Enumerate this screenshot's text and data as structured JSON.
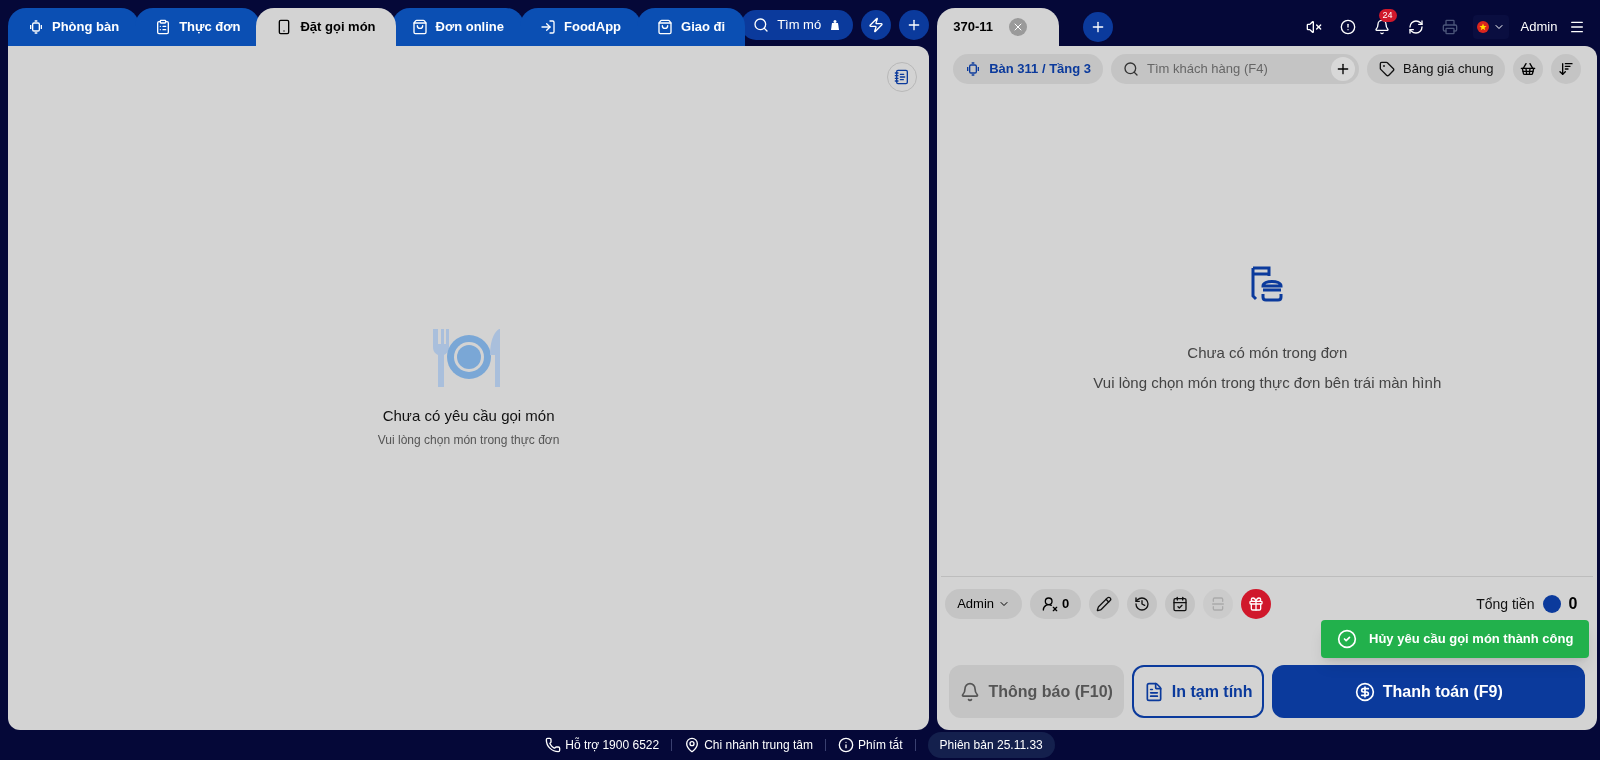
{
  "left_tabs": [
    {
      "kind": "table",
      "label": "Phòng bàn",
      "selected": false
    },
    {
      "kind": "menu",
      "label": "Thực đơn",
      "selected": false
    },
    {
      "kind": "phone",
      "label": "Đặt gọi món",
      "selected": true
    },
    {
      "kind": "bag",
      "label": "Đơn online",
      "selected": false
    },
    {
      "kind": "login",
      "label": "FoodApp",
      "selected": false
    },
    {
      "kind": "bag",
      "label": "Giao đi",
      "selected": false
    }
  ],
  "search_button": {
    "label": "Tìm mó"
  },
  "order_requests": {
    "empty_title": "Chưa có yêu cầu gọi món",
    "empty_hint": "Vui lòng chọn món trong thực đơn"
  },
  "order_tab": {
    "label": "370-11"
  },
  "header_icons": [
    {
      "kind": "mute",
      "disabled": false
    },
    {
      "kind": "alert",
      "disabled": false
    },
    {
      "kind": "bell",
      "disabled": false,
      "badge": "24"
    },
    {
      "kind": "refresh",
      "disabled": false
    },
    {
      "kind": "print",
      "disabled": true
    }
  ],
  "user": "Admin",
  "table_chip": "Bàn 311 / Tầng 3",
  "customer_search": {
    "placeholder": "Tìm khách hàng (F4)"
  },
  "price_list": "Bảng giá chung",
  "cart": {
    "empty_title": "Chưa có món trong đơn",
    "empty_hint": "Vui lòng chọn món trong thực đơn bên trái màn hình"
  },
  "staff_select": "Admin",
  "guest_count": "0",
  "tools": [
    {
      "kind": "edit",
      "disabled": false
    },
    {
      "kind": "history",
      "disabled": false
    },
    {
      "kind": "calendar",
      "disabled": false
    },
    {
      "kind": "split",
      "disabled": true
    },
    {
      "kind": "gift",
      "disabled": false
    }
  ],
  "total": {
    "label": "Tổng tiền",
    "value": "0"
  },
  "actions": [
    {
      "kind": "notify",
      "label": "Thông báo (F10)"
    },
    {
      "kind": "print",
      "label": "In tạm tính"
    },
    {
      "kind": "pay",
      "label": "Thanh toán (F9)"
    }
  ],
  "toast": {
    "message": "Hủy yêu cầu gọi món thành công"
  },
  "footer": [
    {
      "kind": "phone",
      "label": "Hỗ trợ 1900 6522"
    },
    {
      "kind": "location",
      "label": "Chi nhánh trung tâm"
    },
    {
      "kind": "info",
      "label": "Phím tắt"
    },
    {
      "kind": "version",
      "label": "Phiên bản 25.11.33"
    }
  ]
}
